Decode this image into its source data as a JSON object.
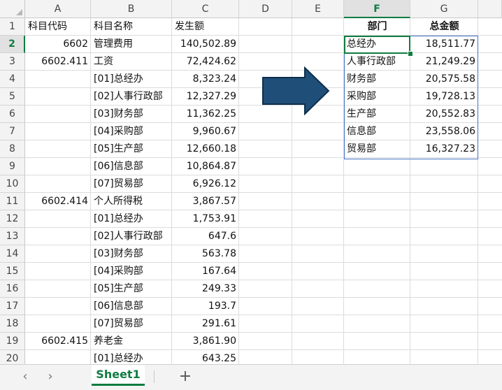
{
  "columns": [
    "A",
    "B",
    "C",
    "D",
    "E",
    "F",
    "G"
  ],
  "rows": [
    "1",
    "2",
    "3",
    "4",
    "5",
    "6",
    "7",
    "8",
    "9",
    "10",
    "11",
    "12",
    "13",
    "14",
    "15",
    "16",
    "17",
    "18",
    "19",
    "20"
  ],
  "left_table": {
    "headers": [
      "科目代码",
      "科目名称",
      "发生额"
    ],
    "rows": [
      [
        "6602",
        "管理费用",
        "140,502.89"
      ],
      [
        "6602.411",
        "工资",
        "72,424.62"
      ],
      [
        "",
        "[01]总经办",
        "8,323.24"
      ],
      [
        "",
        "[02]人事行政部",
        "12,327.29"
      ],
      [
        "",
        "[03]财务部",
        "11,362.25"
      ],
      [
        "",
        "[04]采购部",
        "9,960.67"
      ],
      [
        "",
        "[05]生产部",
        "12,660.18"
      ],
      [
        "",
        "[06]信息部",
        "10,864.87"
      ],
      [
        "",
        "[07]贸易部",
        "6,926.12"
      ],
      [
        "6602.414",
        "个人所得税",
        "3,867.57"
      ],
      [
        "",
        "[01]总经办",
        "1,753.91"
      ],
      [
        "",
        "[02]人事行政部",
        "647.6"
      ],
      [
        "",
        "[03]财务部",
        "563.78"
      ],
      [
        "",
        "[04]采购部",
        "167.64"
      ],
      [
        "",
        "[05]生产部",
        "249.33"
      ],
      [
        "",
        "[06]信息部",
        "193.7"
      ],
      [
        "",
        "[07]贸易部",
        "291.61"
      ],
      [
        "6602.415",
        "养老金",
        "3,861.90"
      ],
      [
        "",
        "[01]总经办",
        "643.25"
      ]
    ]
  },
  "right_table": {
    "headers": [
      "部门",
      "总金额"
    ],
    "rows": [
      [
        "总经办",
        "18,511.77"
      ],
      [
        "人事行政部",
        "21,249.29"
      ],
      [
        "财务部",
        "20,575.58"
      ],
      [
        "采购部",
        "19,728.13"
      ],
      [
        "生产部",
        "20,552.83"
      ],
      [
        "信息部",
        "23,558.06"
      ],
      [
        "贸易部",
        "16,327.23"
      ]
    ]
  },
  "selected_cell": "F2",
  "sheet_tabs": [
    {
      "label": "Sheet1",
      "active": true
    }
  ],
  "icons": {
    "prev": "‹",
    "next": "›",
    "add": "+"
  },
  "colors": {
    "accent": "#107c41",
    "table_border": "#4472c4",
    "arrow_fill": "#1f4e79"
  }
}
